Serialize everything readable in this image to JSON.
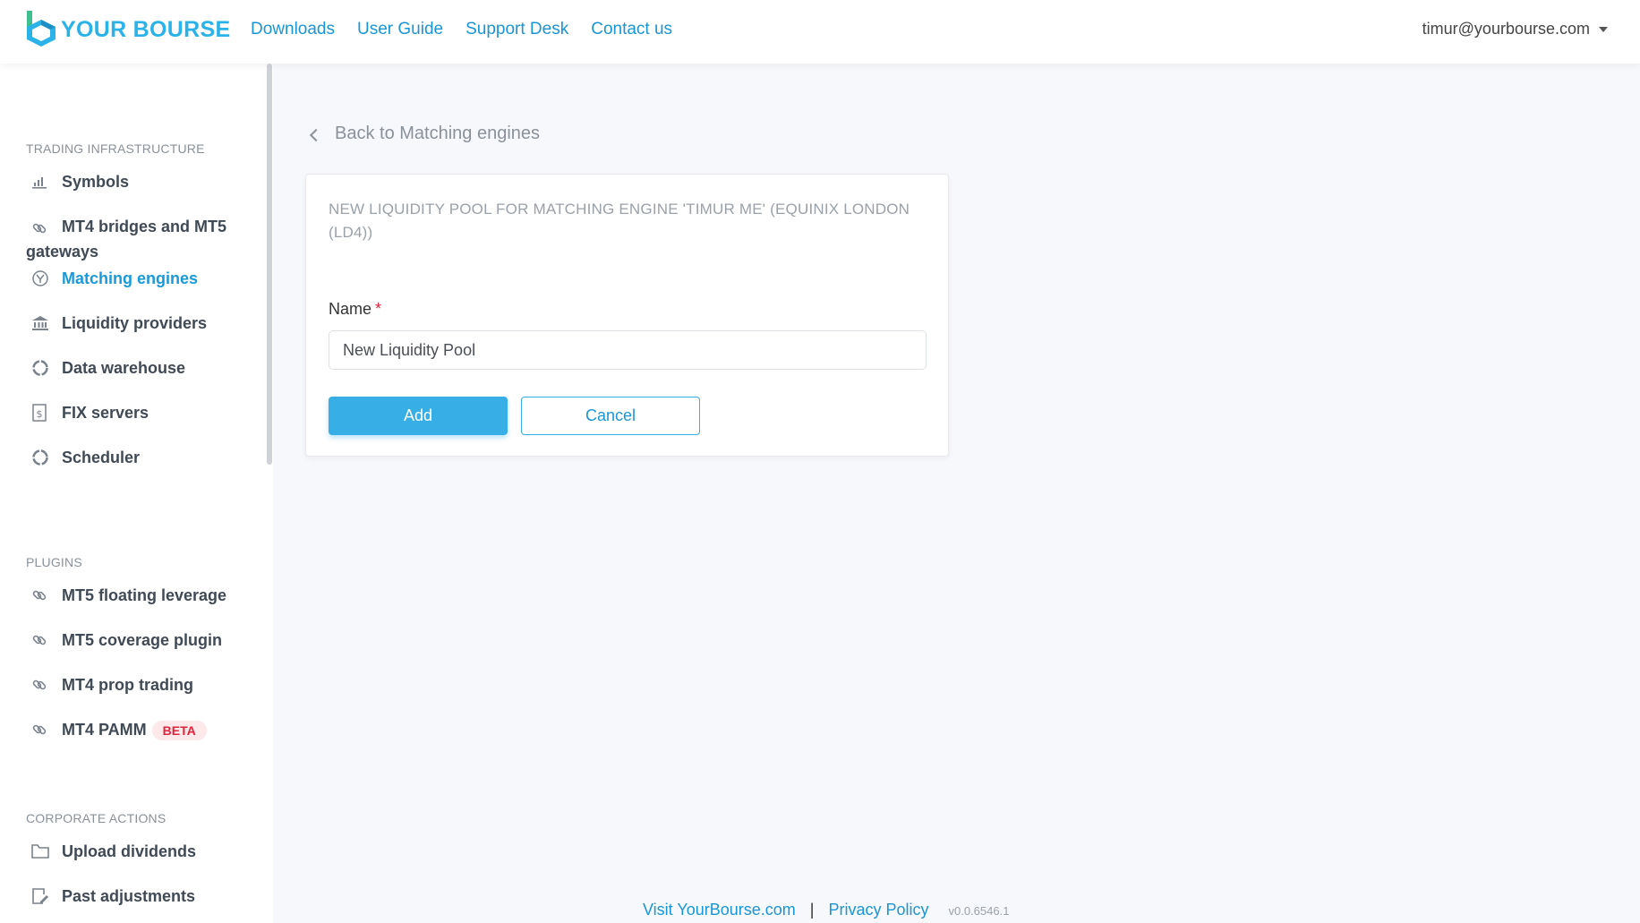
{
  "brand": {
    "name": "YOUR BOURSE",
    "accent": "#2bb2e8"
  },
  "topnav": [
    "Downloads",
    "User Guide",
    "Support Desk",
    "Contact us"
  ],
  "user": {
    "email": "timur@yourbourse.com"
  },
  "sidebar": {
    "sections": [
      {
        "title": "TRADING INFRASTRUCTURE",
        "items": [
          {
            "label": "Symbols",
            "icon": "bar-chart-icon"
          },
          {
            "label": "MT4 bridges and MT5 gateways",
            "icon": "link-icon"
          },
          {
            "label": "Matching engines",
            "icon": "engine-icon",
            "active": true
          },
          {
            "label": "Liquidity providers",
            "icon": "bank-icon"
          },
          {
            "label": "Data warehouse",
            "icon": "circle-icon"
          },
          {
            "label": "FIX servers",
            "icon": "dollar-doc-icon"
          },
          {
            "label": "Scheduler",
            "icon": "circle-icon"
          }
        ]
      },
      {
        "title": "PLUGINS",
        "items": [
          {
            "label": "MT5 floating leverage",
            "icon": "link-icon"
          },
          {
            "label": "MT5 coverage plugin",
            "icon": "link-icon"
          },
          {
            "label": "MT4 prop trading",
            "icon": "link-icon"
          },
          {
            "label": "MT4 PAMM",
            "icon": "link-icon",
            "badge": "BETA"
          }
        ]
      },
      {
        "title": "CORPORATE ACTIONS",
        "items": [
          {
            "label": "Upload dividends",
            "icon": "folder-icon"
          },
          {
            "label": "Past adjustments",
            "icon": "edit-doc-icon"
          }
        ]
      }
    ]
  },
  "main": {
    "back_label": "Back to Matching engines",
    "card_title": "NEW LIQUIDITY POOL FOR MATCHING ENGINE 'TIMUR ME' (EQUINIX LONDON (LD4))",
    "name_label": "Name",
    "required_mark": "*",
    "name_value": "New Liquidity Pool",
    "add_label": "Add",
    "cancel_label": "Cancel"
  },
  "footer": {
    "visit": "Visit YourBourse.com",
    "separator": "|",
    "privacy": "Privacy Policy",
    "version": "v0.0.6546.1"
  }
}
